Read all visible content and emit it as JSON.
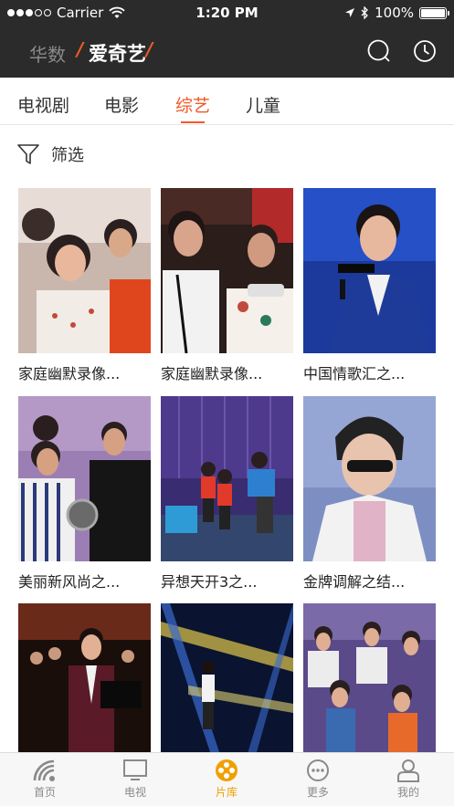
{
  "status_bar": {
    "carrier": "Carrier",
    "time": "1:20 PM",
    "battery": "100%"
  },
  "header": {
    "brand_secondary": "华数",
    "brand_primary": "爱奇艺",
    "slash": "/"
  },
  "tabs": [
    {
      "label": "电视剧",
      "active": false
    },
    {
      "label": "电影",
      "active": false
    },
    {
      "label": "综艺",
      "active": true
    },
    {
      "label": "儿童",
      "active": false
    }
  ],
  "filter": {
    "label": "筛选"
  },
  "cards": [
    {
      "title": "家庭幽默录像..."
    },
    {
      "title": "家庭幽默录像..."
    },
    {
      "title": "中国情歌汇之..."
    },
    {
      "title": "美丽新风尚之..."
    },
    {
      "title": "异想天开3之..."
    },
    {
      "title": "金牌调解之结..."
    },
    {
      "title": ""
    },
    {
      "title": ""
    },
    {
      "title": ""
    }
  ],
  "bottom_tabs": [
    {
      "label": "首页",
      "icon": "home-signal-icon",
      "active": false
    },
    {
      "label": "电视",
      "icon": "tv-icon",
      "active": false
    },
    {
      "label": "片库",
      "icon": "film-reel-icon",
      "active": true
    },
    {
      "label": "更多",
      "icon": "more-icon",
      "active": false
    },
    {
      "label": "我的",
      "icon": "person-icon",
      "active": false
    }
  ],
  "colors": {
    "accent": "#f05a28",
    "active_tab_icon": "#f0a000",
    "header_bg": "#2b2b2b"
  }
}
